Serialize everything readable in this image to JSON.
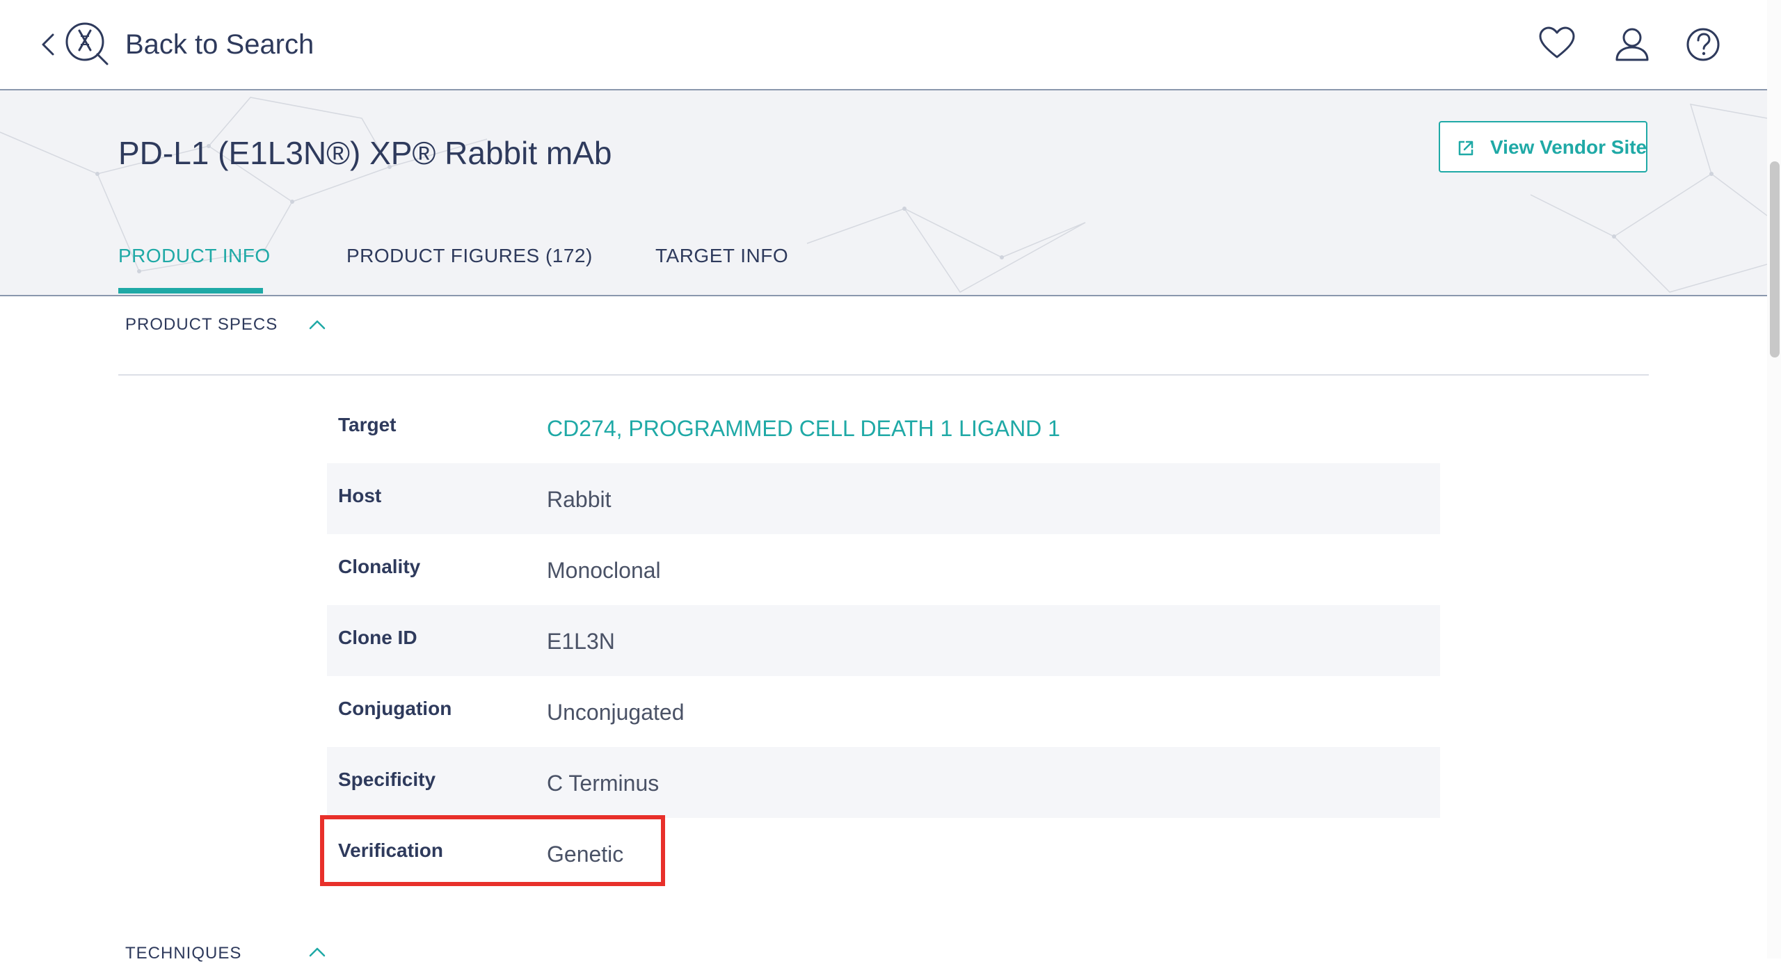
{
  "nav": {
    "back_label": "Back to Search"
  },
  "product": {
    "title": "PD-L1 (E1L3N®) XP® Rabbit mAb",
    "vendor_button": "View Vendor Site"
  },
  "tabs": [
    {
      "label": "PRODUCT INFO",
      "active": true
    },
    {
      "label": "PRODUCT FIGURES (172)",
      "active": false
    },
    {
      "label": "TARGET INFO",
      "active": false
    }
  ],
  "sections": {
    "specs_title": "PRODUCT SPECS",
    "techniques_title": "TECHNIQUES"
  },
  "specs": [
    {
      "key": "Target",
      "value": "CD274, PROGRAMMED CELL DEATH 1 LIGAND 1"
    },
    {
      "key": "Host",
      "value": "Rabbit"
    },
    {
      "key": "Clonality",
      "value": "Monoclonal"
    },
    {
      "key": "Clone ID",
      "value": "E1L3N"
    },
    {
      "key": "Conjugation",
      "value": "Unconjugated"
    },
    {
      "key": "Specificity",
      "value": "C Terminus"
    },
    {
      "key": "Verification",
      "value": "Genetic"
    }
  ],
  "icons": {
    "back": "chevron-left-icon",
    "logo": "app-logo-icon",
    "favorite": "heart-icon",
    "account": "user-icon",
    "help": "help-icon",
    "external": "external-link-icon",
    "collapse": "chevron-up-icon"
  },
  "colors": {
    "accent": "#1fa9a6",
    "text": "#2e3a5c",
    "highlight": "#e8302a",
    "header_bg": "#f2f3f6",
    "row_alt": "#f5f6f9"
  }
}
